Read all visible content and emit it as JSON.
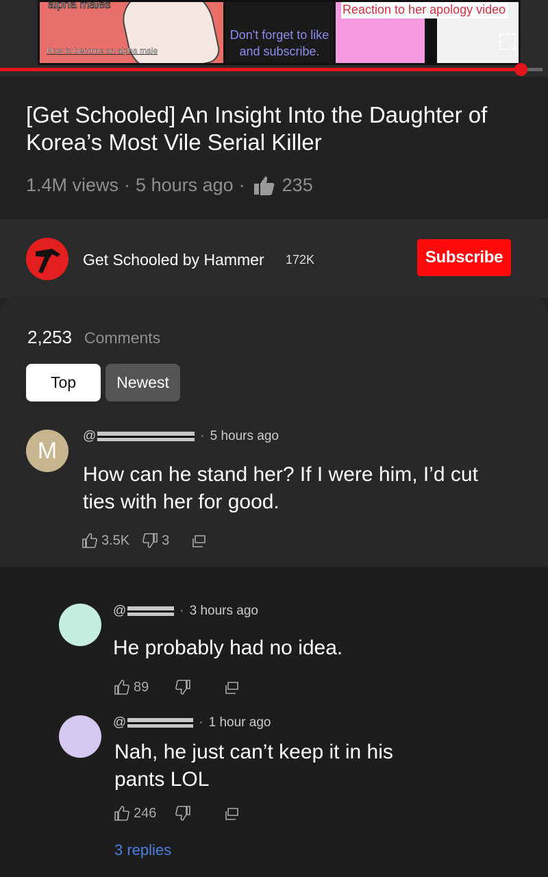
{
  "player": {
    "thumb1_caption_top": "alpha males",
    "thumb1_caption_bottom": "How to become an alpha male",
    "thumb2_caption": "Don't forget to like and subscribe.",
    "thumb3_caption": "Reaction to her apology video",
    "progress_fraction": 0.96,
    "accent": "#e3161a"
  },
  "video": {
    "title": "[Get Schooled] An Insight Into the Daughter of Korea’s Most Vile Serial Killer",
    "views": "1.4M views",
    "age": "5 hours ago",
    "likes": "235"
  },
  "channel": {
    "name": "Get Schooled by Hammer",
    "subs": "172K",
    "subscribe_label": "Subscribe",
    "icon": "hammer-icon"
  },
  "comments": {
    "count": "2,253",
    "label": "Comments",
    "tabs": {
      "top": "Top",
      "newest": "Newest"
    },
    "main": {
      "avatar_letter": "M",
      "handle_prefix": "@",
      "time": "5 hours ago",
      "text": "How can he stand her? If I were him, I’d cut ties with her for good.",
      "likes": "3.5K",
      "dislikes": "3"
    },
    "replies": [
      {
        "handle_prefix": "@",
        "time": "3 hours ago",
        "text": "He probably had no idea.",
        "likes": "89"
      },
      {
        "handle_prefix": "@",
        "time": "1 hour ago",
        "text": "Nah, he just can’t keep it in his pants LOL",
        "likes": "246"
      }
    ],
    "more_replies": "3 replies"
  }
}
